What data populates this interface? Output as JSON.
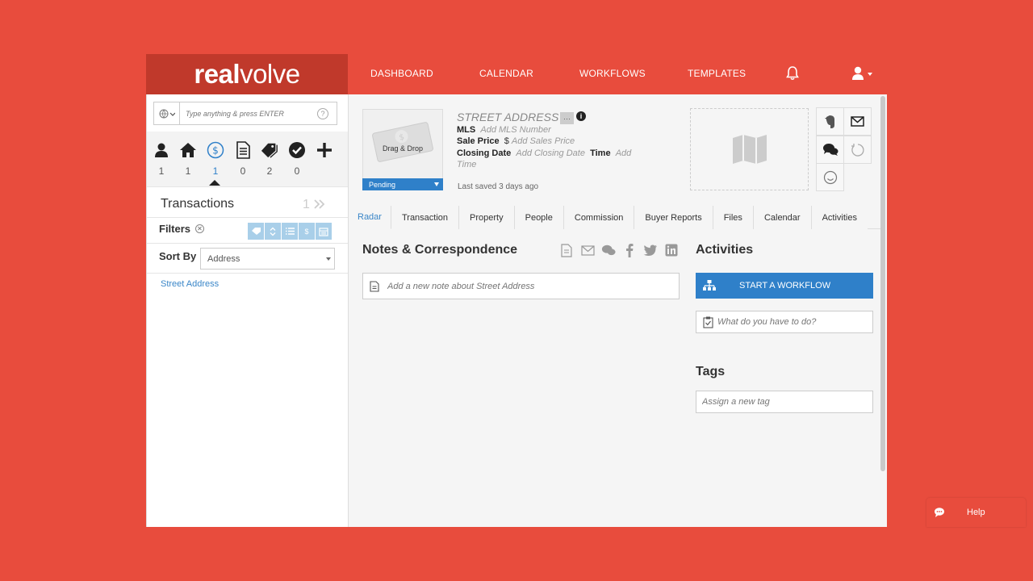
{
  "brand": {
    "bold": "real",
    "light": "volve"
  },
  "nav": {
    "items": [
      "DASHBOARD",
      "CALENDAR",
      "WORKFLOWS",
      "TEMPLATES"
    ]
  },
  "search": {
    "placeholder": "Type anything & press ENTER",
    "help": "?"
  },
  "categories": [
    {
      "icon": "person-icon",
      "count": "1"
    },
    {
      "icon": "house-icon",
      "count": "1"
    },
    {
      "icon": "dollar-icon",
      "count": "1",
      "active": true
    },
    {
      "icon": "document-icon",
      "count": "0"
    },
    {
      "icon": "tags-icon",
      "count": "2"
    },
    {
      "icon": "checkmark-icon",
      "count": "0"
    },
    {
      "icon": "plus-icon",
      "count": ""
    }
  ],
  "sidebar": {
    "title": "Transactions",
    "count": "1",
    "filters_label": "Filters",
    "sort_label": "Sort By",
    "sort_value": "Address",
    "items": [
      "Street Address"
    ]
  },
  "property": {
    "dropzone_label": "Drag & Drop",
    "status": "Pending",
    "address": "STREET ADDRESS",
    "more": "···",
    "mls_label": "MLS",
    "mls_placeholder": "Add MLS Number",
    "price_label": "Sale Price",
    "price_currency": "$",
    "price_placeholder": "Add Sales Price",
    "closing_label": "Closing Date",
    "closing_placeholder": "Add Closing Date",
    "time_label": "Time",
    "time_placeholder_1": "Add",
    "time_placeholder_2": "Time",
    "last_saved": "Last saved 3 days ago"
  },
  "tabs": [
    "Radar",
    "Transaction",
    "Property",
    "People",
    "Commission",
    "Buyer Reports",
    "Files",
    "Calendar",
    "Activities"
  ],
  "notes": {
    "title": "Notes & Correspondence",
    "placeholder": "Add a new note about Street Address"
  },
  "activities": {
    "title": "Activities",
    "start_workflow": "START A WORKFLOW",
    "todo_placeholder": "What do you have to do?"
  },
  "tags": {
    "title": "Tags",
    "placeholder": "Assign a new tag"
  },
  "help": {
    "label": "Help"
  },
  "colors": {
    "brand_red": "#e84c3d",
    "accent_blue": "#2f80c9",
    "link_blue": "#3a86c8"
  }
}
